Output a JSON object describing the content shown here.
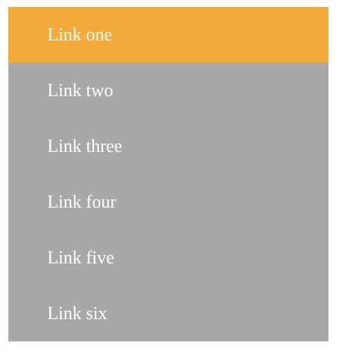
{
  "nav": {
    "active_color": "#f3ab3c",
    "background_color": "#a8a8a8",
    "items": [
      {
        "label": "Link one",
        "active": true
      },
      {
        "label": "Link two",
        "active": false
      },
      {
        "label": "Link three",
        "active": false
      },
      {
        "label": "Link four",
        "active": false
      },
      {
        "label": "Link five",
        "active": false
      },
      {
        "label": "Link six",
        "active": false
      }
    ]
  }
}
